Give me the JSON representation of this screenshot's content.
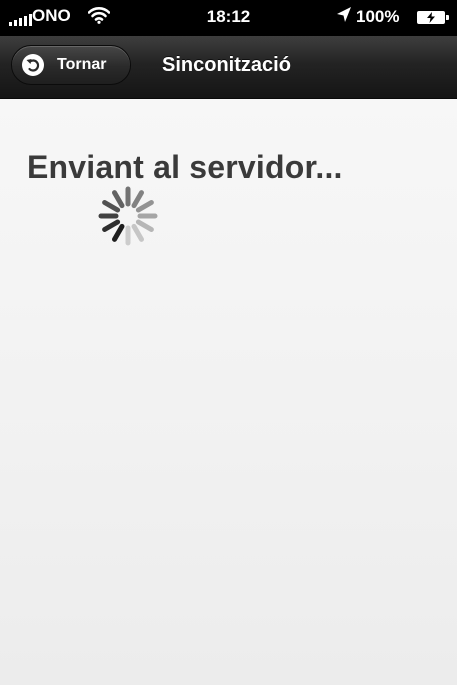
{
  "status_bar": {
    "carrier": "ONO",
    "time": "18:12",
    "battery": "100%",
    "icons": [
      "signal-icon",
      "wifi-icon",
      "location-arrow-icon",
      "battery-charging-icon"
    ]
  },
  "nav_bar": {
    "back_label": "Tornar",
    "back_icon": "back-arrow-icon",
    "title": "Sinconització"
  },
  "content": {
    "message": "Enviant al servidor...",
    "indicator": "activity-spinner-icon"
  },
  "colors": {
    "status_bar_bg": "#000000",
    "nav_bar_bg": "#232323",
    "content_bg": "#f1f1f1",
    "message_text": "#3a3a3a",
    "spinner": "#1e1e1e"
  }
}
